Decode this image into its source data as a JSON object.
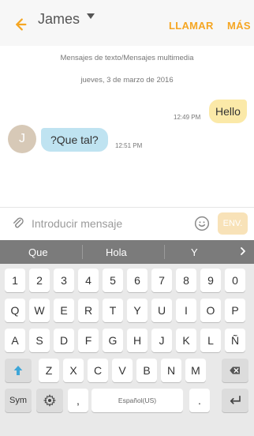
{
  "header": {
    "contact_name": "James",
    "call_label": "LLAMAR",
    "more_label": "MÁS",
    "accent_color": "#f5a623"
  },
  "chat": {
    "meta_type": "Mensajes de texto/Mensajes multimedia",
    "meta_date": "jueves, 3 de marzo de 2016",
    "outgoing": {
      "text": "Hello",
      "time": "12:49 PM"
    },
    "incoming": {
      "avatar_initial": "J",
      "text": "?Que tal?",
      "time": "12:51 PM"
    }
  },
  "composer": {
    "placeholder": "Introducir mensaje",
    "send_label": "ENV."
  },
  "suggestions": [
    "Que",
    "Hola",
    "Y"
  ],
  "keyboard": {
    "row1": [
      "1",
      "2",
      "3",
      "4",
      "5",
      "6",
      "7",
      "8",
      "9",
      "0"
    ],
    "row2": [
      "Q",
      "W",
      "E",
      "R",
      "T",
      "Y",
      "U",
      "I",
      "O",
      "P"
    ],
    "row3": [
      "A",
      "S",
      "D",
      "F",
      "G",
      "H",
      "J",
      "K",
      "L",
      "Ñ"
    ],
    "row4": [
      "Z",
      "X",
      "C",
      "V",
      "B",
      "N",
      "M"
    ],
    "sym_label": "Sym",
    "comma_label": ",",
    "space_label": "Español(US)",
    "period_label": "."
  }
}
